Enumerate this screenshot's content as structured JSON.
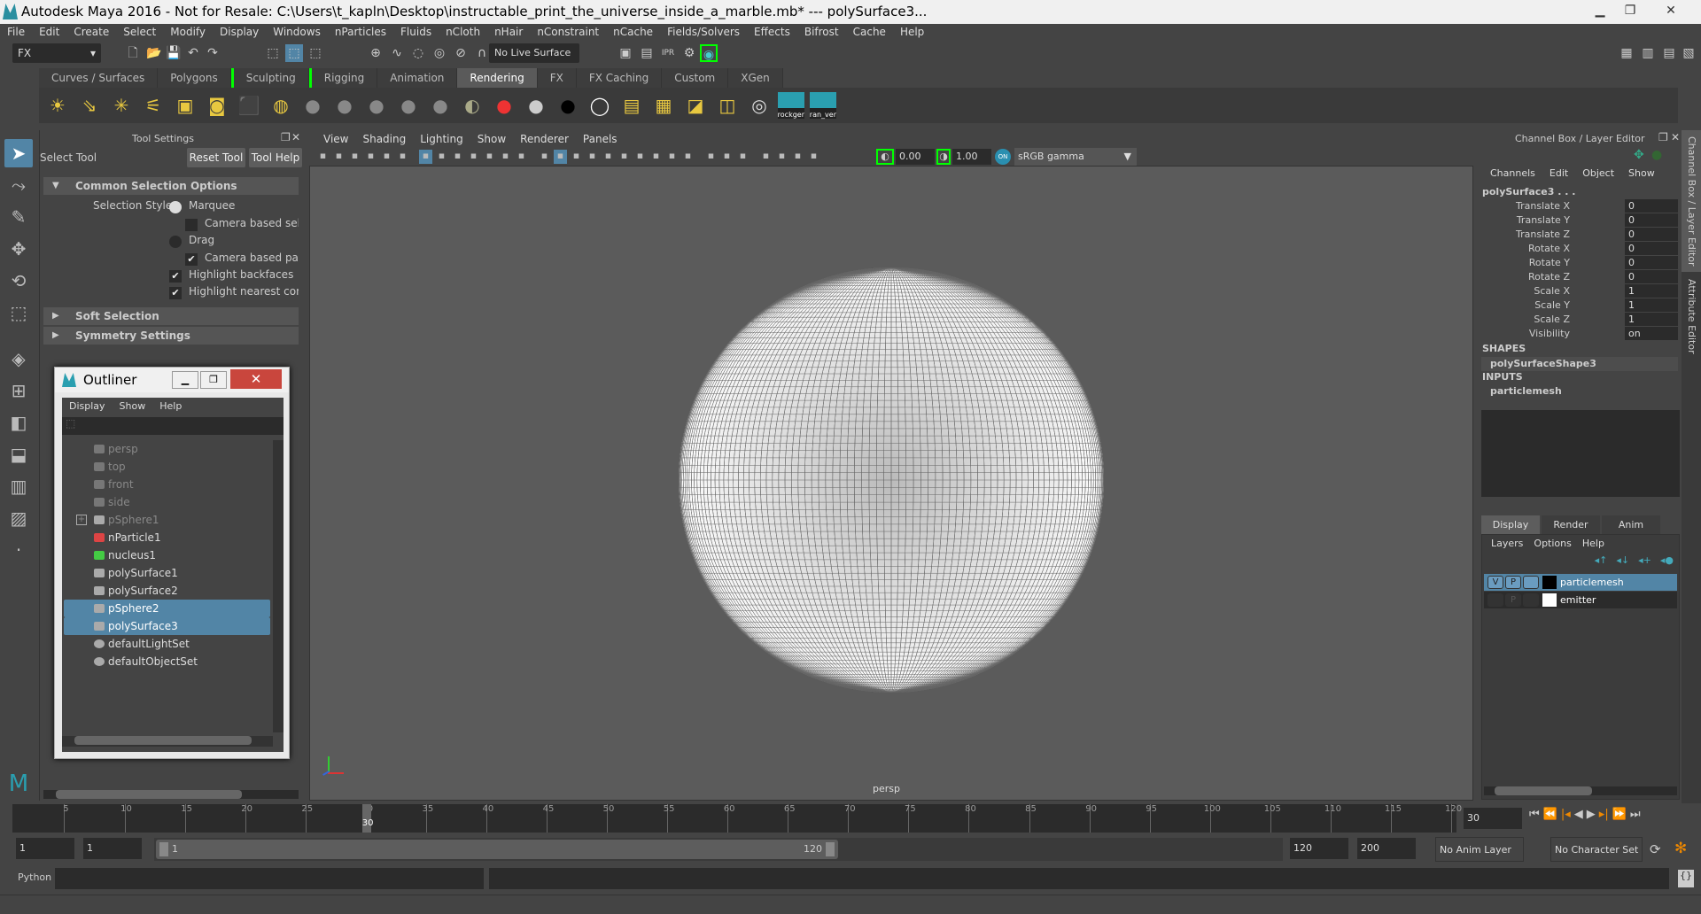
{
  "window": {
    "title": "Autodesk Maya 2016 - Not for Resale: C:\\Users\\t_kapln\\Desktop\\instructable_print_the_universe_inside_a_marble.mb*   ---   polySurface3..."
  },
  "menubar": [
    "File",
    "Edit",
    "Create",
    "Select",
    "Modify",
    "Display",
    "Windows",
    "nParticles",
    "Fluids",
    "nCloth",
    "nHair",
    "nConstraint",
    "nCache",
    "Fields/Solvers",
    "Effects",
    "Bifrost",
    "Cache",
    "Help"
  ],
  "toolbar": {
    "menuset": "FX",
    "live_surface": "No Live Surface"
  },
  "shelf": {
    "tabs": [
      "Curves / Surfaces",
      "Polygons",
      "Sculpting",
      "Rigging",
      "Animation",
      "Rendering",
      "FX",
      "FX Caching",
      "Custom",
      "XGen"
    ],
    "active": "Rendering",
    "icons": [
      "ambient-light-icon",
      "directional-light-icon",
      "point-light-icon",
      "spot-light-icon",
      "area-light-icon",
      "volume-light-icon",
      "camera-icon",
      "hypershade-icon",
      "blinn-icon",
      "lambert-icon",
      "phong-icon",
      "phonge-icon",
      "anisotropic-icon",
      "layered-shader-icon",
      "ramp-shader-icon",
      "surface-shader-white-icon",
      "surface-shader-black-icon",
      "surface-shader-outline-icon",
      "render-view-icon",
      "render-icon",
      "ipr-icon",
      "batch-render-icon",
      "render-settings-icon"
    ],
    "custom": [
      "rockger",
      "ran_ver"
    ]
  },
  "tool_settings": {
    "header": "Tool Settings",
    "tool": "Select Tool",
    "reset": "Reset Tool",
    "help": "Tool Help",
    "common": "Common Selection Options",
    "selection_style": "Selection Style:",
    "marquee": "Marquee",
    "camera_select": "Camera based selection",
    "drag": "Drag",
    "camera_paint": "Camera based paint selection",
    "backfaces": "Highlight backfaces",
    "nearest": "Highlight nearest component",
    "soft": "Soft Selection",
    "symmetry": "Symmetry Settings"
  },
  "outliner": {
    "title": "Outliner",
    "menus": [
      "Display",
      "Show",
      "Help"
    ],
    "items": [
      {
        "name": "persp",
        "type": "camera",
        "dim": true
      },
      {
        "name": "top",
        "type": "camera",
        "dim": true
      },
      {
        "name": "front",
        "type": "camera",
        "dim": true
      },
      {
        "name": "side",
        "type": "camera",
        "dim": true
      },
      {
        "name": "pSphere1",
        "type": "mesh",
        "dim": true,
        "expand": true
      },
      {
        "name": "nParticle1",
        "type": "particle"
      },
      {
        "name": "nucleus1",
        "type": "nucleus"
      },
      {
        "name": "polySurface1",
        "type": "mesh"
      },
      {
        "name": "polySurface2",
        "type": "mesh"
      },
      {
        "name": "pSphere2",
        "type": "mesh",
        "selected": true
      },
      {
        "name": "polySurface3",
        "type": "mesh",
        "selected": true
      },
      {
        "name": "defaultLightSet",
        "type": "set"
      },
      {
        "name": "defaultObjectSet",
        "type": "set"
      }
    ]
  },
  "viewport": {
    "menus": [
      "View",
      "Shading",
      "Lighting",
      "Show",
      "Renderer",
      "Panels"
    ],
    "exposure": "0.00",
    "gamma": "1.00",
    "colorspace": "sRGB gamma",
    "camera_label": "persp"
  },
  "channel_box": {
    "header": "Channel Box / Layer Editor",
    "menus": [
      "Channels",
      "Edit",
      "Object",
      "Show"
    ],
    "object": "polySurface3 . . .",
    "attrs": [
      {
        "n": "Translate X",
        "v": "0"
      },
      {
        "n": "Translate Y",
        "v": "0"
      },
      {
        "n": "Translate Z",
        "v": "0"
      },
      {
        "n": "Rotate X",
        "v": "0"
      },
      {
        "n": "Rotate Y",
        "v": "0"
      },
      {
        "n": "Rotate Z",
        "v": "0"
      },
      {
        "n": "Scale X",
        "v": "1"
      },
      {
        "n": "Scale Y",
        "v": "1"
      },
      {
        "n": "Scale Z",
        "v": "1"
      },
      {
        "n": "Visibility",
        "v": "on"
      }
    ],
    "shapes_label": "SHAPES",
    "shape": "polySurfaceShape3",
    "inputs_label": "INPUTS",
    "input": "particlemesh",
    "layer_tabs": [
      "Display",
      "Render",
      "Anim"
    ],
    "layer_menus": [
      "Layers",
      "Options",
      "Help"
    ],
    "layers": [
      {
        "name": "particlemesh",
        "color": "#000000",
        "v": "V",
        "p": "P",
        "selected": true
      },
      {
        "name": "emitter",
        "color": "#ffffff",
        "v": "",
        "p": "P"
      }
    ],
    "side_tabs": [
      "Channel Box / Layer Editor",
      "Attribute Editor"
    ]
  },
  "timeline": {
    "ticks": [
      5,
      10,
      15,
      20,
      25,
      30,
      35,
      40,
      45,
      50,
      55,
      60,
      65,
      70,
      75,
      80,
      85,
      90,
      95,
      100,
      105,
      110,
      115,
      120
    ],
    "min": 1,
    "max": 120,
    "current": "30"
  },
  "range": {
    "start": "1",
    "playback_start": "1",
    "slider_start": "1",
    "slider_end": "120",
    "playback_end": "120",
    "end": "200",
    "anim_layer": "No Anim Layer",
    "character_set": "No Character Set"
  },
  "command": {
    "language": "Python"
  },
  "colors": {
    "selection": "#5285a6",
    "accent_green": "#00ff00"
  }
}
